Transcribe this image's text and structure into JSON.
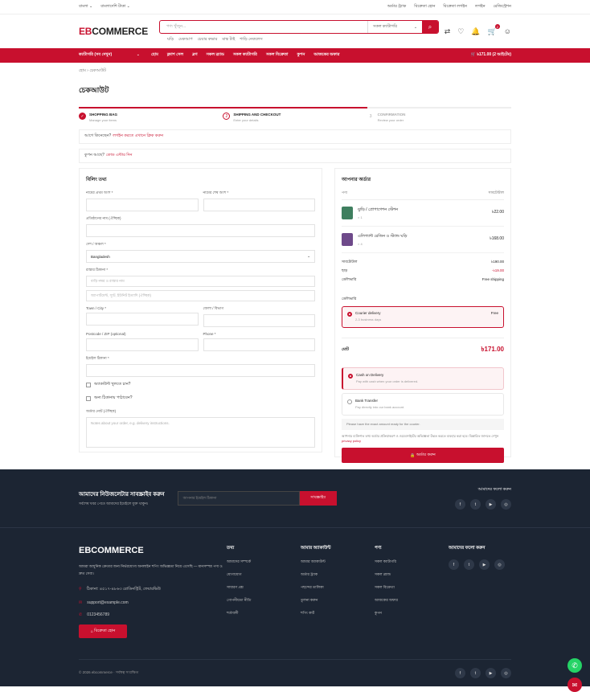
{
  "topbar": {
    "lang": "বাংলা ⌄",
    "currency": "বাংলাদেশি টাকা ⌄",
    "links": [
      "অর্ডার ট্র্যাক",
      "বিক্রেতা হোন",
      "বিক্রেতা লগইন",
      "লগইন",
      "রেজিস্ট্রেশন"
    ]
  },
  "header": {
    "logo_a": "EB",
    "logo_b": "COMMERCE",
    "search_placeholder": "পণ্য খুঁজুন...",
    "category": "সকল ক্যাটাগরি",
    "tags": [
      "ঘড়ি",
      "মেকআপ",
      "চেয়ার কভার",
      "মাস্ক টাই",
      "শাড়ি নেকলেস"
    ],
    "cart_badge": "2"
  },
  "nav": {
    "categories": "ক্যাটাগরি (সব দেখুন)",
    "links": [
      "হোম",
      "ফ্ল্যাশ সেল",
      "ব্লগ",
      "সকল ব্র্যান্ড",
      "সকল ক্যাটাগরি",
      "সকল বিক্রেতা",
      "কুপন",
      "আজকের অফার"
    ],
    "cart": "৳171.00 (2 আইটেম)"
  },
  "breadcrumb": "হোম › চেকআউট",
  "page_title": "চেকআউট",
  "steps": [
    {
      "num": "1",
      "title": "SHOPPING BAG",
      "sub": "Manage your items"
    },
    {
      "num": "2",
      "title": "SHIPPING AND CHECKOUT",
      "sub": "Enter your details"
    },
    {
      "num": "3",
      "title": "CONFIRMATION",
      "sub": "Review your order"
    }
  ],
  "notice_login": {
    "text": "আগে কিনেছেন?",
    "link": "লগইন করতে এখানে ক্লিক করুন"
  },
  "notice_coupon": {
    "text": "কুপন আছে?",
    "link": "কোড এন্টার দিন"
  },
  "billing": {
    "title": "বিলিং তথ্য",
    "first_name": "নামের প্রথম অংশ *",
    "last_name": "নামের শেষ অংশ *",
    "company": "প্রতিষ্ঠানের নাম (ঐচ্ছিক)",
    "country_label": "দেশ / অঞ্চল *",
    "country": "Bangladesh",
    "address_label": "রাস্তার ঠিকানা *",
    "address_ph1": "বাড়ি নম্বর ও রাস্তার নাম",
    "address_ph2": "অ্যাপার্টমেন্ট, স্যুট, ইউনিট ইত্যাদি (ঐচ্ছিক)",
    "town": "Town / City *",
    "state": "জেলা / বিভাগ",
    "postcode": "Postcode / ZIP (optional)",
    "phone": "Phone *",
    "email": "ইমেইল ঠিকানা *",
    "create_account": "অ্যাকাউন্ট খুলতে চান?",
    "ship_diff": "অন্য ঠিকানায় পাঠাবেন?",
    "notes_label": "অর্ডার নোট (ঐচ্ছিক)",
    "notes_ph": "Notes about your order, e.g. delivery instructions."
  },
  "order": {
    "title": "আপনার অর্ডার",
    "col_product": "পণ্য",
    "col_subtotal": "সাবটোটাল",
    "items": [
      {
        "name": "ঝুড়ি / প্রোপাগেশন স্টেশন",
        "qty": "× 1",
        "price": "৳22.00",
        "color": "#3f7f5f"
      },
      {
        "name": "এলিগ্যান্ট রেজিন ও স্ট্যান্ড ঘড়ি",
        "qty": "× 4",
        "price": "৳168.00",
        "color": "#6e4a8a"
      }
    ],
    "subtotal_label": "সাবটোটাল",
    "subtotal": "৳190.00",
    "discount_label": "ছাড়",
    "discount": "-৳19.00",
    "shipping_label": "ডেলিভারি",
    "shipping": "Free shipping",
    "delivery_label": "ডেলিভারি",
    "delivery_name": "Courier delivery",
    "delivery_sub": "2-3 business days",
    "delivery_fee": "Free",
    "total_label": "মোট",
    "total": "৳171.00",
    "payments": [
      {
        "name": "Cash on Delivery",
        "sub": "Pay with cash when your order is delivered."
      },
      {
        "name": "Bank Transfer",
        "sub": "Pay directly into our bank account."
      }
    ],
    "pay_note": "Please have the exact amount ready for the courier.",
    "policy": "আপনার ব্যক্তিগত তথ্য অর্ডার প্রক্রিয়াকরণ ও ওয়েবসাইটের অভিজ্ঞতা উন্নত করতে ব্যবহার করা হবে। বিস্তারিত জানতে দেখুন",
    "policy_link": "privacy policy",
    "place_order": "অর্ডার করুন"
  },
  "newsletter": {
    "title": "আমাদের নিউজলেটার সাবস্ক্রাইব করুন",
    "sub": "সর্বশেষ খবর পেতে আমাদের ইমেইলে যুক্ত থাকুন।",
    "placeholder": "আপনার ইমেইল ঠিকানা",
    "button": "সাবস্ক্রাইব",
    "follow": "আমাদের ফলো করুন"
  },
  "footer": {
    "logo": "EBCOMMERCE",
    "desc": "আমরা আধুনিক ক্রেতার জন্য নির্ভরযোগ্য অনলাইন শপিং অভিজ্ঞতা নিয়ে এসেছি — মানসম্পন্ন পণ্য ও দ্রুত সেবা।",
    "address": "ঠিকানা: ৪৫১৭-৪৮৬৩ রোডিনস্ট্রিট, ফেয়ারভিউ",
    "email": "support@example.com",
    "phone": "0123456789",
    "shop_btn": "বিক্রেতা হোন",
    "cols": [
      {
        "title": "তথ্য",
        "items": [
          "আমাদের সম্পর্কে",
          "যোগাযোগ",
          "সাধারণ প্রশ্ন",
          "গোপনীয়তা নীতি",
          "শর্তাবলী"
        ]
      },
      {
        "title": "আমার অ্যাকাউন্ট",
        "items": [
          "আমার অ্যাকাউন্ট",
          "অর্ডার ট্র্যাক",
          "পছন্দের তালিকা",
          "তুলনা করুন",
          "শপিং কার্ট"
        ]
      },
      {
        "title": "পণ্য",
        "items": [
          "সকল ক্যাটাগরি",
          "সকল ব্র্যান্ড",
          "সকল বিক্রেতা",
          "আজকের অফার",
          "কুপন"
        ]
      }
    ],
    "follow": "আমাদের ফলো করুন",
    "copyright": "© 2026 ebcommerce · সর্বস্বত্ব সংরক্ষিত"
  }
}
